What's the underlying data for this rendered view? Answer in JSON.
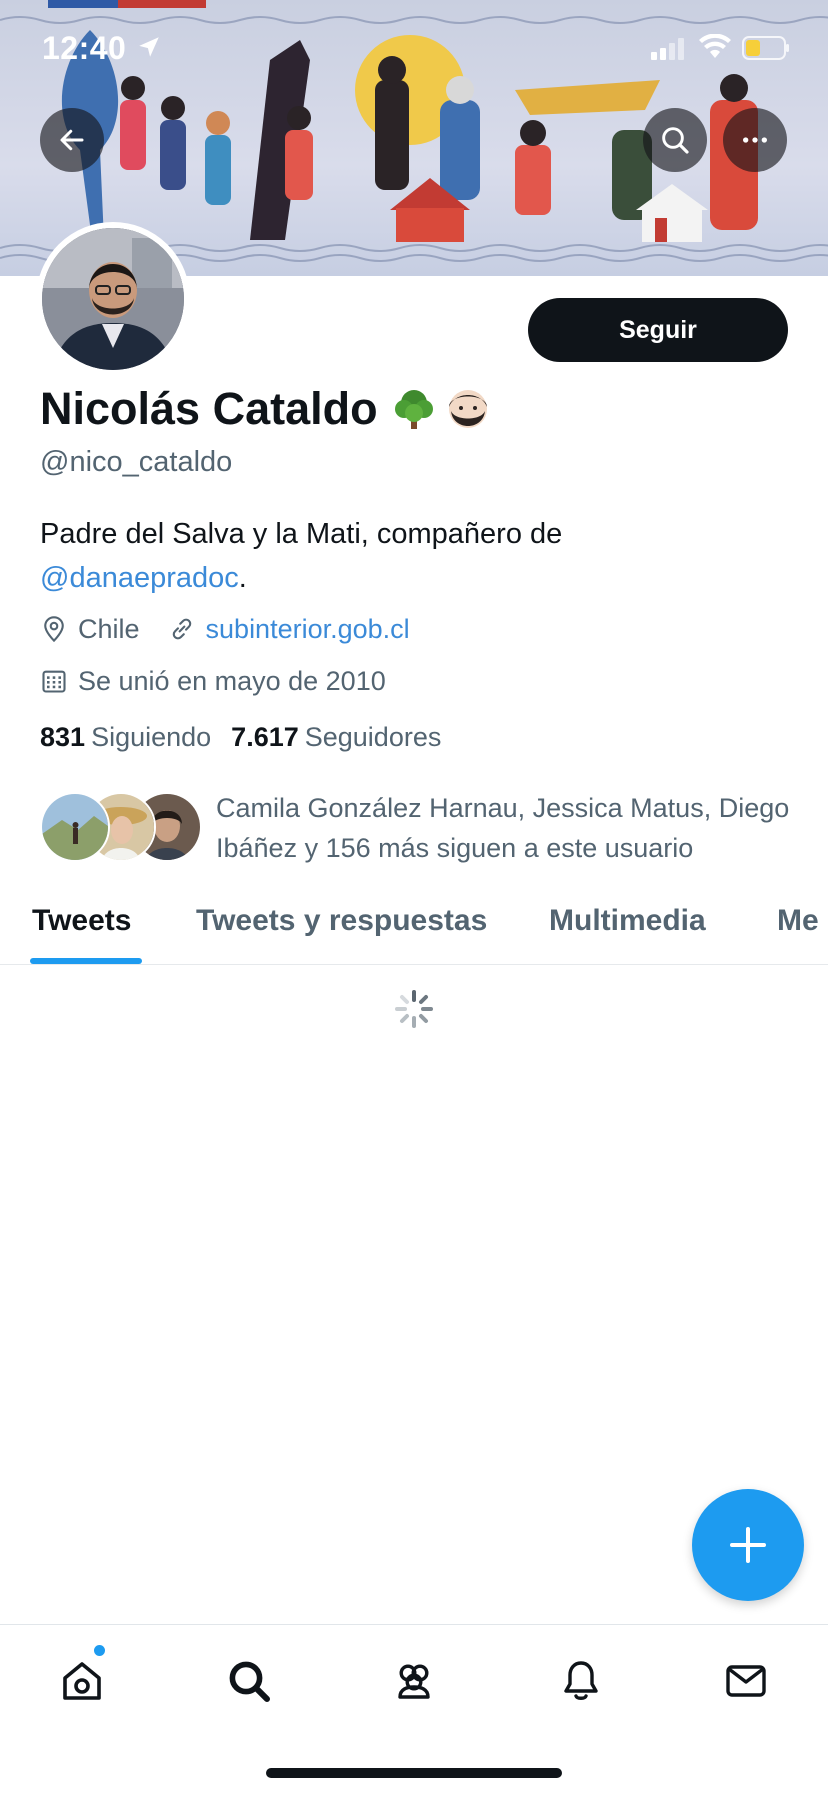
{
  "status_bar": {
    "time": "12:40"
  },
  "banner": {
    "icons": [
      "back-arrow-icon",
      "search-icon",
      "more-icon"
    ]
  },
  "profile": {
    "name": "Nicolás Cataldo",
    "name_emojis": [
      "🌳",
      "🧔🏻"
    ],
    "handle": "@nico_cataldo",
    "follow_label": "Seguir",
    "bio_text": "Padre del Salva y la Mati, compañero de",
    "bio_mention": "@danaepradoc",
    "bio_end": ".",
    "location": "Chile",
    "website": "subinterior.gob.cl",
    "joined": "Se unió en mayo de 2010",
    "following_count": "831",
    "following_label": "Siguiendo",
    "followers_count": "7.617",
    "followers_label": "Seguidores",
    "mutuals_text": "Camila González Harnau, Jessica Matus, Diego Ibáñez y 156 más siguen a este usuario"
  },
  "tabs": [
    {
      "label": "Tweets",
      "active": true
    },
    {
      "label": "Tweets y respuestas",
      "active": false
    },
    {
      "label": "Multimedia",
      "active": false
    },
    {
      "label": "Me",
      "active": false
    }
  ],
  "bottom_nav": {
    "items": [
      "home-icon",
      "search-icon",
      "communities-icon",
      "notifications-icon",
      "messages-icon"
    ],
    "home_has_dot": true
  },
  "colors": {
    "accent": "#1d9bf0",
    "text_primary": "#0f1419",
    "text_secondary": "#536471",
    "follow_button_bg": "#0f1419"
  }
}
